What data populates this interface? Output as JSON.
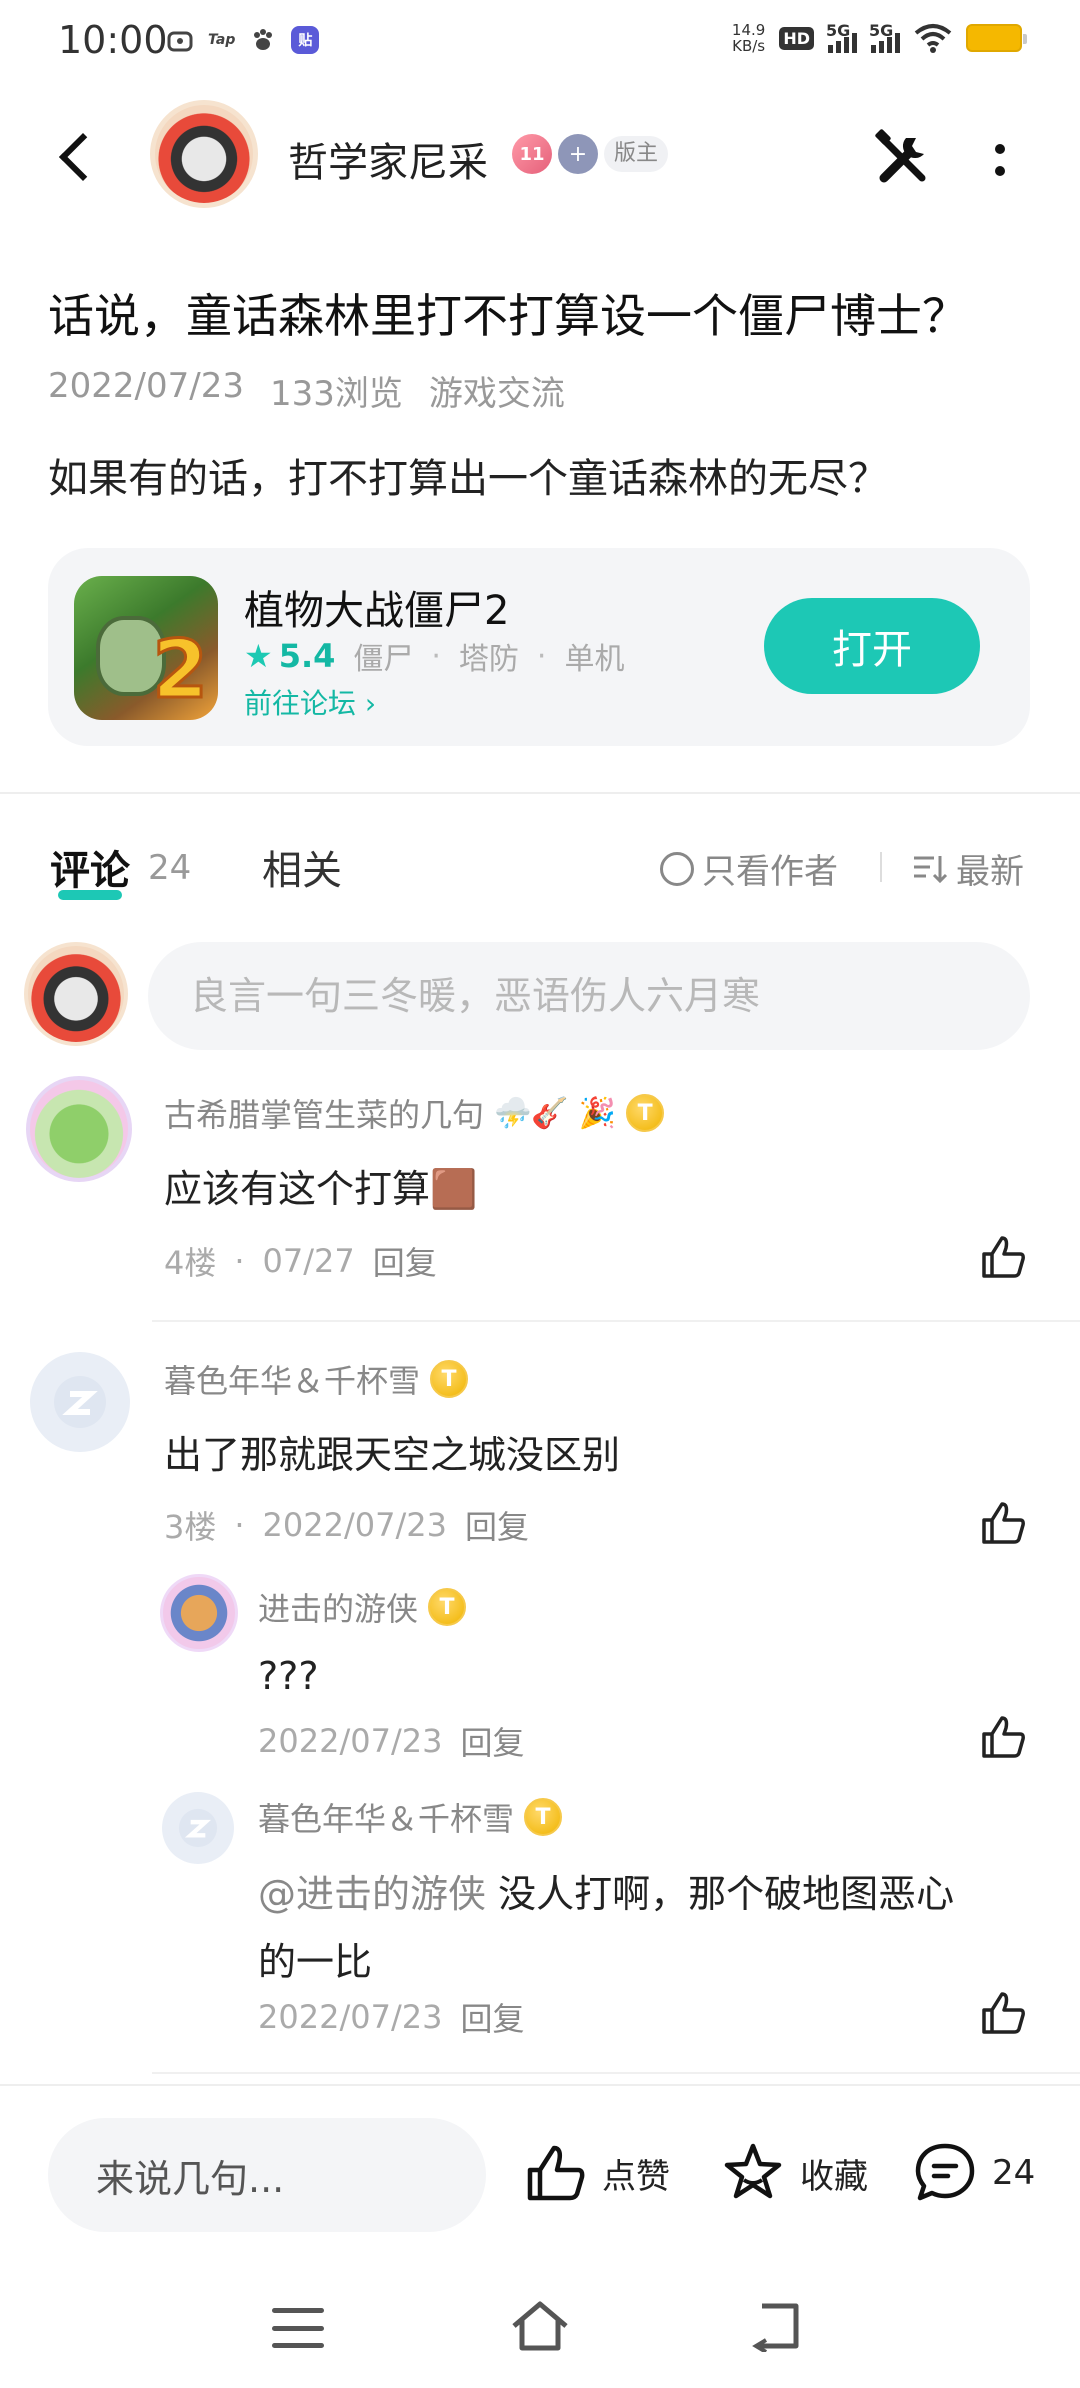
{
  "status_bar": {
    "time": "10:00",
    "apps": [
      "TV",
      "Tap",
      "Baidu",
      "Tieba"
    ],
    "net_speed": "14.9",
    "net_unit": "KB/s",
    "hd": "HD",
    "signal1": "5G",
    "signal2": "5G"
  },
  "header": {
    "author": "哲学家尼采",
    "badge_level": "11",
    "badge_user": "+",
    "badge_role": "版主"
  },
  "post": {
    "title": "话说，童话森林里打不打算设一个僵尸博士？",
    "date": "2022/07/23",
    "views": "133浏览",
    "category": "游戏交流",
    "body": "如果有的话，打不打算出一个童话森林的无尽？"
  },
  "game_card": {
    "name": "植物大战僵尸2",
    "rating": "5.4",
    "tags": [
      "僵尸",
      "塔防",
      "单机"
    ],
    "forum_link": "前往论坛",
    "open_label": "打开",
    "icon_number": "2"
  },
  "tabs": {
    "comments_label": "评论",
    "comments_count": "24",
    "related_label": "相关",
    "author_only": "只看作者",
    "sort": "最新"
  },
  "reply_input": {
    "placeholder": "良言一句三冬暖，恶语伤人六月寒"
  },
  "comments": [
    {
      "name": "古希腊掌管生菜的几句",
      "emoji": "⛈️🎸",
      "level": "T",
      "text": "应该有这个打算",
      "floor": "4楼",
      "date": "07/27",
      "reply": "回复"
    },
    {
      "name": "暮色年华＆千杯雪",
      "level": "T",
      "text": "出了那就跟天空之城没区别",
      "floor": "3楼",
      "date": "2022/07/23",
      "reply": "回复",
      "replies": [
        {
          "name": "进击的游侠",
          "level": "T",
          "text": "???",
          "date": "2022/07/23",
          "reply": "回复"
        },
        {
          "name": "暮色年华＆千杯雪",
          "level": "T",
          "mention": "@进击的游侠",
          "text_line1": "没人打啊，那个破地图恶心",
          "text_line2": "的一比",
          "date": "2022/07/23",
          "reply": "回复"
        }
      ]
    }
  ],
  "bottom_bar": {
    "input_label": "来说几句...",
    "like_label": "点赞",
    "fav_label": "收藏",
    "comment_count": "24"
  },
  "colors": {
    "accent": "#1dc8b5",
    "gold_badge": "#f0b400"
  }
}
